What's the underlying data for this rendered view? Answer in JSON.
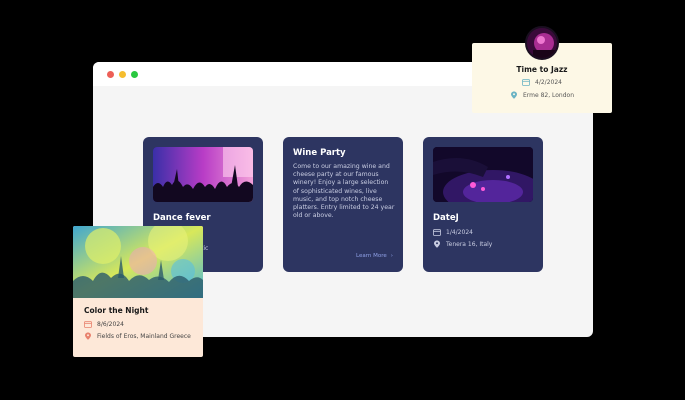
{
  "cards": [
    {
      "title": "Dance fever",
      "meta_partial": "tic"
    },
    {
      "title": "Wine Party",
      "description": "Come to our amazing wine and cheese party at our famous winery! Enjoy a large selection of sophisticated wines, live music, and top notch cheese platters. Entry limited to 24 year old or above.",
      "link": "Learn More"
    },
    {
      "title": "DateJ",
      "date": "1/4/2024",
      "location": "Tenera 16, Italy"
    }
  ],
  "color_card": {
    "title": "Color the Night",
    "date": "8/6/2024",
    "location": "Fields of Eros, Mainland Greece"
  },
  "jazz_card": {
    "title": "Time to Jazz",
    "date": "4/2/2024",
    "location": "Erme 82, London"
  },
  "colors": {
    "card_bg": "#2d3561",
    "cream": "#fdf8e6",
    "peach": "#fde8d8",
    "accent": "#e8816d",
    "teal": "#6ab3c4"
  },
  "icons": [
    "calendar-icon",
    "location-pin-icon",
    "chevron-right-icon"
  ]
}
